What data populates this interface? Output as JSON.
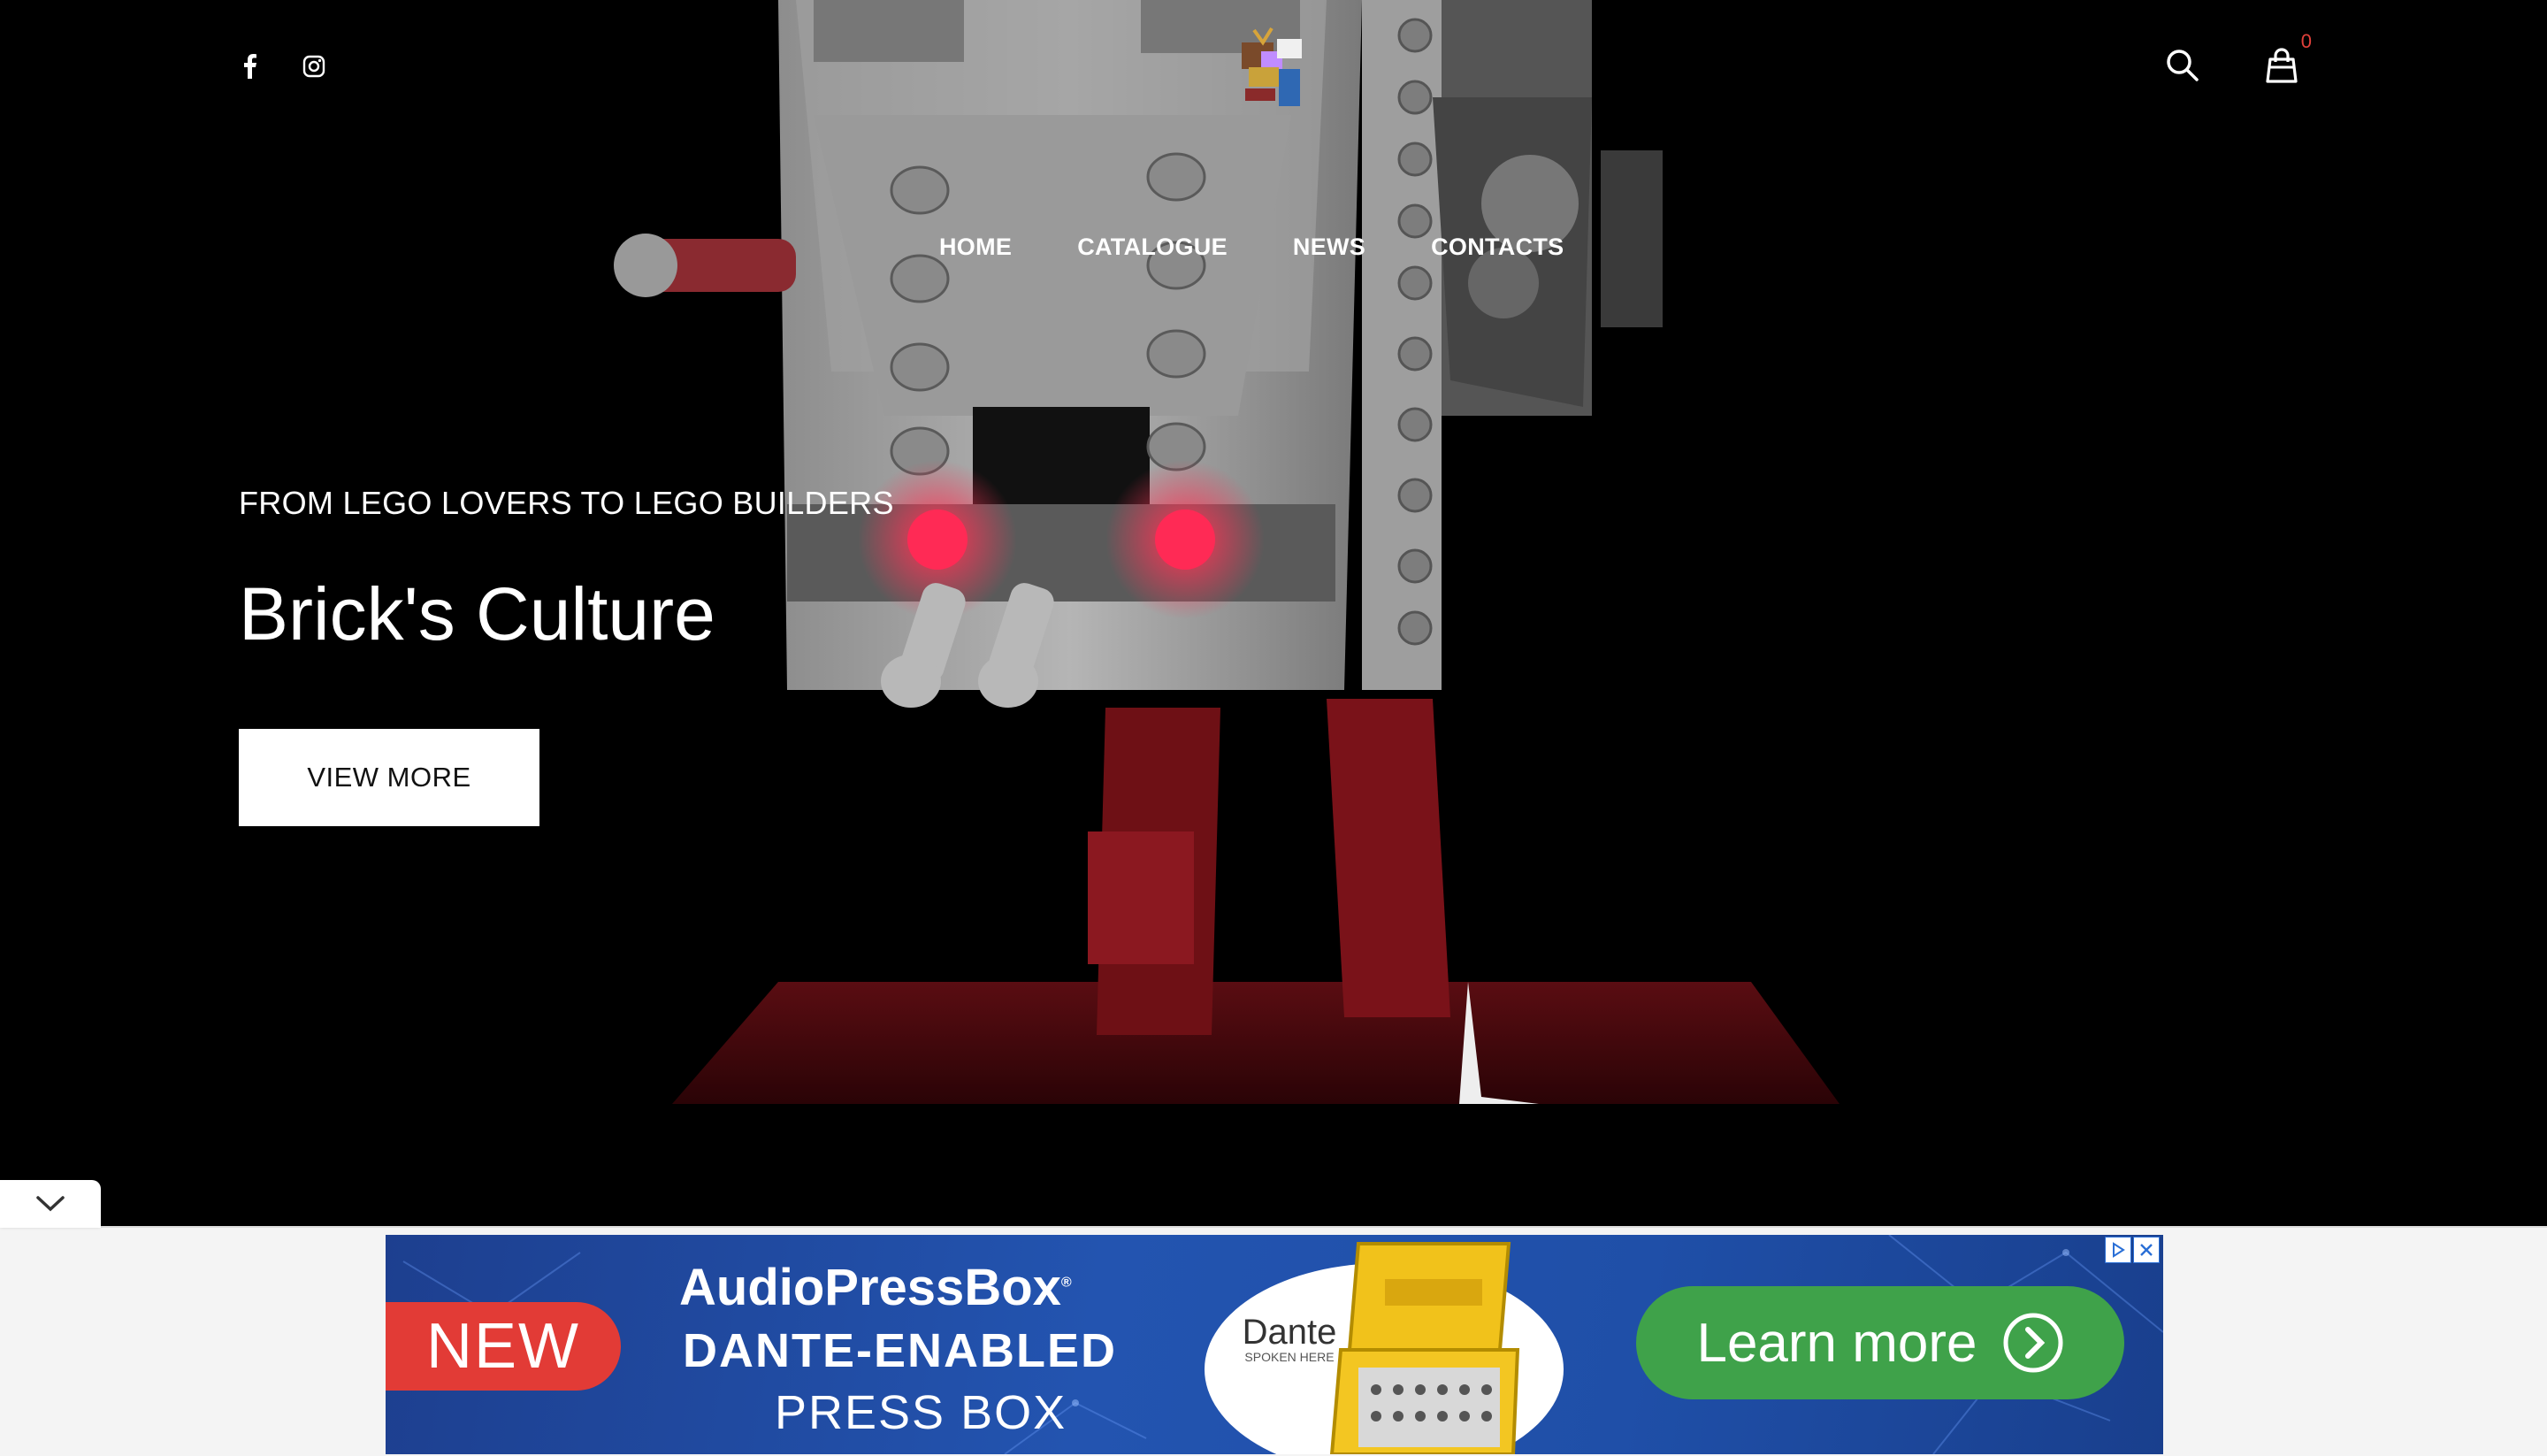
{
  "header": {
    "social": [
      {
        "icon": "facebook-icon",
        "glyph": "f"
      },
      {
        "icon": "instagram-icon"
      }
    ],
    "cart_count": "0"
  },
  "nav": {
    "items": [
      {
        "label": "HOME"
      },
      {
        "label": "CATALOGUE"
      },
      {
        "label": "NEWS"
      },
      {
        "label": "CONTACTS"
      }
    ]
  },
  "hero": {
    "tagline": "FROM LEGO LOVERS TO LEGO BUILDERS",
    "title": "Brick's Culture",
    "cta_label": "VIEW MORE"
  },
  "ad": {
    "badge": "NEW",
    "brand": "AudioPressBox",
    "brand_mark": "®",
    "headline": "DANTE-ENABLED",
    "subline": "PRESS BOX",
    "partner": "Dante",
    "partner_sub": "SPOKEN HERE",
    "cta": "Learn more"
  },
  "colors": {
    "accent_red": "#e0403a",
    "ad_blue": "#2354b0",
    "ad_green": "#3fa24a"
  }
}
